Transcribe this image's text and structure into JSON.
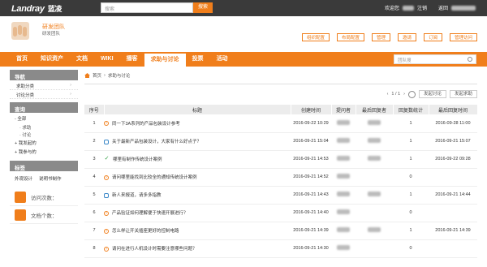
{
  "topbar": {
    "logo": "Landray",
    "logo_cn": "蓝凌",
    "search_placeholder": "搜索",
    "search_btn": "搜索",
    "welcome": "欢迎您",
    "logout": "注销",
    "return_home": "返回"
  },
  "header": {
    "team_name": "研发团队",
    "team_sub": "研发团队",
    "buttons": [
      "组织配置",
      "布局配置",
      "管理",
      "邀请",
      "订阅",
      "管理访问"
    ]
  },
  "nav": {
    "items": [
      "首页",
      "知识资产",
      "文档",
      "WIKI",
      "播客",
      "求助与讨论",
      "投票",
      "活动"
    ],
    "active_index": 5,
    "search_placeholder": "团队搜"
  },
  "sidebar": {
    "nav_title": "导航",
    "nav_items": [
      "求助分类",
      "讨论分类"
    ],
    "query_title": "查询",
    "all_label": "- 全部",
    "subs": [
      "· 求助",
      "· 讨论"
    ],
    "my_posts": "+ 我发起的",
    "my_joined": "+ 我参与的",
    "tags_title": "标签",
    "tags": [
      "外观设计",
      "说明书制作"
    ],
    "visits_label": "访问次数：",
    "docs_label": "文档个数："
  },
  "main": {
    "breadcrumb": [
      "首页",
      "求助与讨论"
    ],
    "page": "1 / 1",
    "btn_discuss": "发起讨论",
    "btn_help": "发起求助",
    "columns": [
      "序号",
      "标题",
      "创建时间",
      "提问者",
      "最后回复者",
      "回复数统计",
      "最后回复时间"
    ],
    "rows": [
      {
        "no": "1",
        "icon": "question",
        "title": "同一下3A系列的产品包装设计参考",
        "created": "2016-09-22 10:29",
        "replies": "1",
        "last": "2016-09-28 11:00"
      },
      {
        "no": "2",
        "icon": "chat",
        "title": "关于最新产品包装设计，大家有什么好点子？",
        "created": "2016-09-21 15:04",
        "replies": "1",
        "last": "2016-09-21 15:07"
      },
      {
        "no": "3",
        "icon": "check",
        "title": "哪里有制作传统设计案例",
        "created": "2016-09-21 14:53",
        "replies": "1",
        "last": "2016-09-22 09:28"
      },
      {
        "no": "4",
        "icon": "question",
        "title": "请问哪里能找到比较全的通知传统设计案例",
        "created": "2016-09-21 14:52",
        "replies": "0",
        "last": ""
      },
      {
        "no": "5",
        "icon": "chat",
        "title": "新人来报道，请多多指教",
        "created": "2016-09-21 14:43",
        "replies": "1",
        "last": "2016-09-21 14:44"
      },
      {
        "no": "6",
        "icon": "question",
        "title": "产品验证如何理解便于快速开展进行？",
        "created": "2016-09-21 14:40",
        "replies": "0",
        "last": ""
      },
      {
        "no": "7",
        "icon": "question",
        "title": "怎么样让开关插座更好的控制电路",
        "created": "2016-09-21 14:39",
        "replies": "1",
        "last": "2016-09-21 14:39"
      },
      {
        "no": "8",
        "icon": "question",
        "title": "请问在进行人机设计时需要注意哪些问题？",
        "created": "2016-09-21 14:30",
        "replies": "0",
        "last": ""
      }
    ]
  },
  "colors": {
    "accent": "#f07e1b",
    "topbar": "#3a3a3a"
  }
}
